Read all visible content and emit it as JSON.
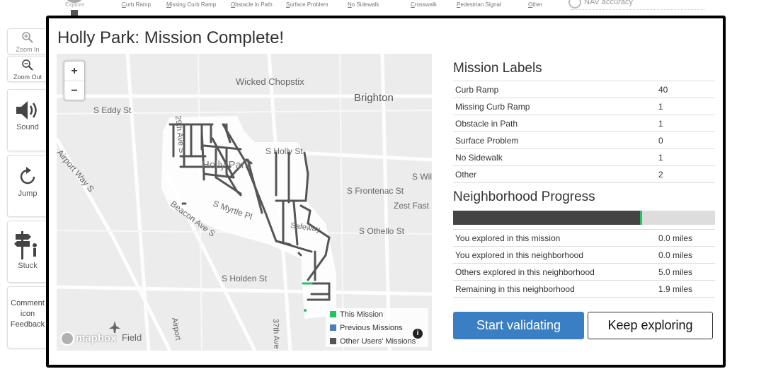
{
  "toolbar": {
    "explore": "Explore",
    "items": [
      "Curb Ramp",
      "Missing Curb Ramp",
      "Obstacle in Path",
      "Surface Problem",
      "No Sidewalk",
      "Crosswalk",
      "Pedestrian Signal",
      "Other"
    ],
    "nav_accuracy": "NAV accuracy"
  },
  "side_tools": {
    "zoom_in": "Zoom In",
    "zoom_out": "Zoom Out",
    "sound": "Sound",
    "jump": "Jump",
    "stuck": "Stuck",
    "comment_alt": "Comment icon",
    "feedback": "Feedback"
  },
  "modal": {
    "title": "Holly Park: Mission Complete!"
  },
  "map": {
    "zoom_in": "+",
    "zoom_out": "−",
    "attribution": "mapbox",
    "info": "i",
    "street_labels": {
      "wicked_chopstix": "Wicked Chopstix",
      "brighton": "Brighton",
      "eddy": "S Eddy St",
      "ave29": "29th Ave S",
      "airport_way": "Airport Way S",
      "holly_park": "Holly Park",
      "holly_st": "S Holly St",
      "wil": "S Wil",
      "frontenac": "S Frontenac St",
      "zest": "Zest Fast",
      "beacon": "Beacon Ave S",
      "myrtle": "S Myrtle Pl",
      "safeway": "Safeway",
      "othello": "S Othello St",
      "holden": "S Holden St",
      "field": "Field",
      "airport": "Airport",
      "ave37": "37th Ave S"
    },
    "legend": [
      {
        "label": "This Mission",
        "color": "#22c266"
      },
      {
        "label": "Previous Missions",
        "color": "#4a7fb5"
      },
      {
        "label": "Other Users' Missions",
        "color": "#555555"
      }
    ]
  },
  "mission_labels": {
    "title": "Mission Labels",
    "rows": [
      {
        "label": "Curb Ramp",
        "value": "40"
      },
      {
        "label": "Missing Curb Ramp",
        "value": "1"
      },
      {
        "label": "Obstacle in Path",
        "value": "1"
      },
      {
        "label": "Surface Problem",
        "value": "0"
      },
      {
        "label": "No Sidewalk",
        "value": "1"
      },
      {
        "label": "Other",
        "value": "2"
      }
    ]
  },
  "neighborhood_progress": {
    "title": "Neighborhood Progress",
    "completed_fraction": 0.72,
    "rows": [
      {
        "label": "You explored in this mission",
        "value": "0.0 miles"
      },
      {
        "label": "You explored in this neighborhood",
        "value": "0.0 miles"
      },
      {
        "label": "Others explored in this neighborhood",
        "value": "5.0 miles"
      },
      {
        "label": "Remaining in this neighborhood",
        "value": "1.9 miles"
      }
    ]
  },
  "buttons": {
    "validate": "Start validating",
    "explore": "Keep exploring"
  }
}
